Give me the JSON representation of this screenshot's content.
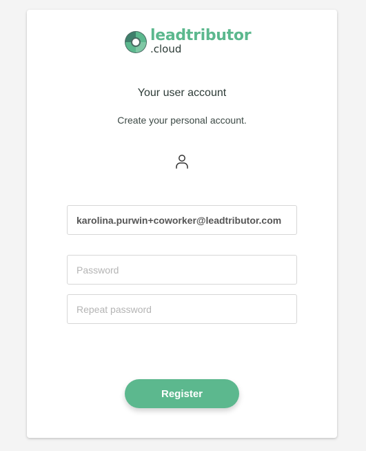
{
  "brand": {
    "name": "leadtributor",
    "suffix": ".cloud",
    "logo_icon": "leadtributor-swirl-icon",
    "accent_color": "#5cb88e"
  },
  "header": {
    "title": "Your user account",
    "subtitle": "Create your personal account."
  },
  "icons": {
    "user": "user-icon"
  },
  "form": {
    "email_value": "karolina.purwin+coworker@leadtributor.com",
    "password_placeholder": "Password",
    "repeat_password_placeholder": "Repeat password",
    "submit_label": "Register"
  }
}
